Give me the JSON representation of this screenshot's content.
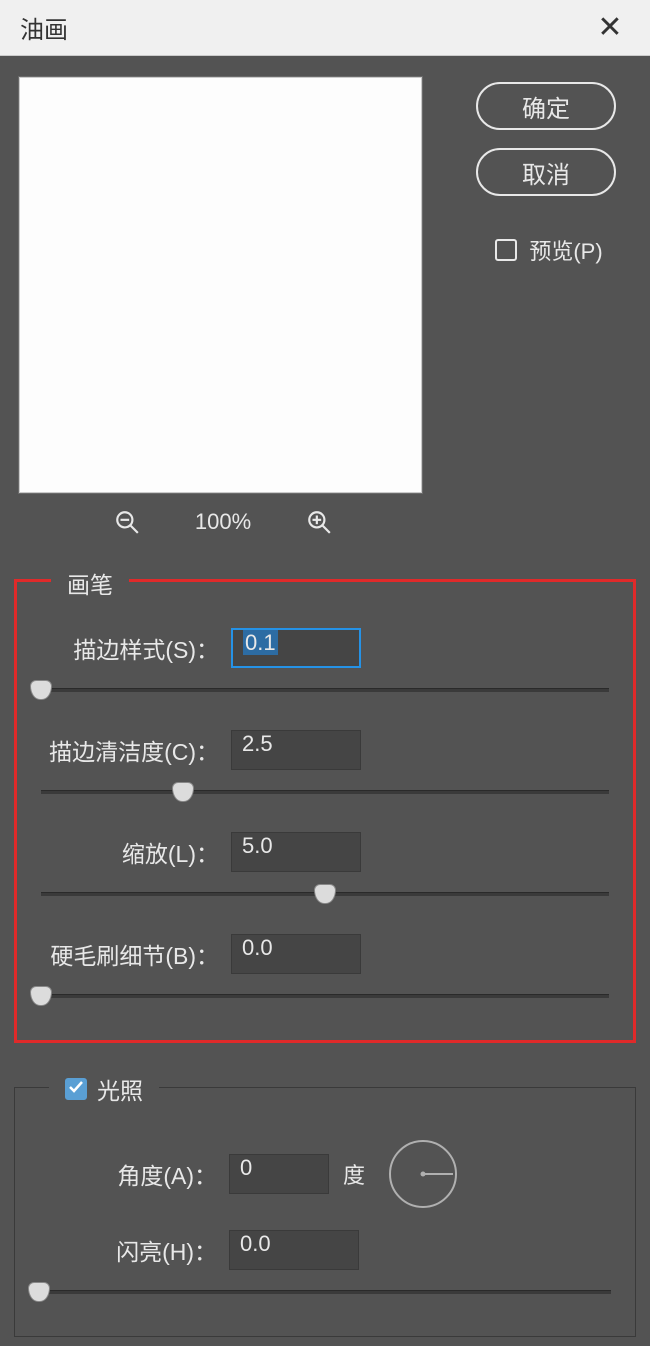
{
  "title": "油画",
  "buttons": {
    "ok": "确定",
    "cancel": "取消",
    "preview_label": "预览(P)"
  },
  "preview": {
    "zoom": "100%",
    "checked": false
  },
  "brush_group": {
    "legend": "画笔",
    "stroke_style": {
      "label": "描边样式(S)：",
      "value": "0.1",
      "slider_pct": 0
    },
    "stroke_clean": {
      "label": "描边清洁度(C)：",
      "value": "2.5",
      "slider_pct": 25
    },
    "scale": {
      "label": "缩放(L)：",
      "value": "5.0",
      "slider_pct": 50
    },
    "bristle": {
      "label": "硬毛刷细节(B)：",
      "value": "0.0",
      "slider_pct": 0
    }
  },
  "light_group": {
    "legend": "光照",
    "checked": true,
    "angle": {
      "label": "角度(A)：",
      "value": "0",
      "unit": "度"
    },
    "shine": {
      "label": "闪亮(H)：",
      "value": "0.0",
      "slider_pct": 0
    }
  }
}
